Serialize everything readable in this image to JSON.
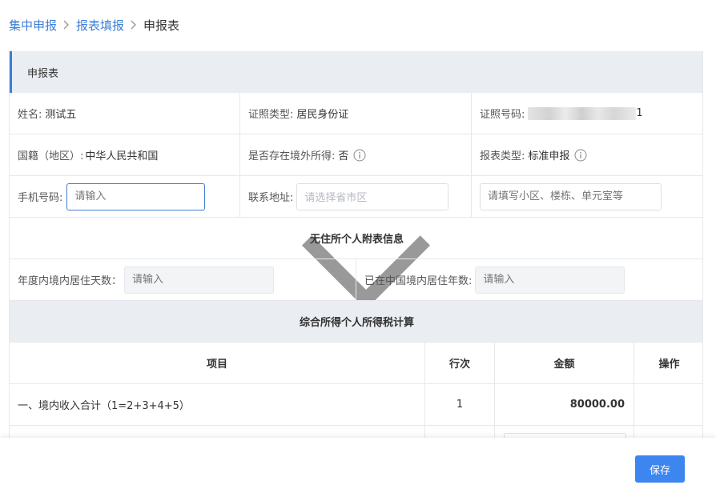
{
  "breadcrumb": {
    "items": [
      "集中申报",
      "报表填报",
      "申报表"
    ]
  },
  "section": {
    "title": "申报表"
  },
  "basic_info": {
    "name_label": "姓名:",
    "name_value": "测试五",
    "id_type_label": "证照类型:",
    "id_type_value": "居民身份证",
    "id_number_label": "证照号码:",
    "id_number_suffix": "1",
    "nationality_label": "国籍（地区）:",
    "nationality_value": "中华人民共和国",
    "overseas_income_label": "是否存在境外所得:",
    "overseas_income_value": "否",
    "report_type_label": "报表类型:",
    "report_type_value": "标准申报",
    "phone_label": "手机号码:",
    "phone_placeholder": "请输入",
    "address_label": "联系地址:",
    "address_placeholder": "请选择省市区",
    "detail_address_placeholder": "请填写小区、楼栋、单元室等"
  },
  "non_resident": {
    "title": "无住所个人附表信息",
    "days_label": "年度内境内居住天数：",
    "days_placeholder": "请输入",
    "years_label": "已在中国境内居住年数:",
    "years_placeholder": "请输入"
  },
  "tax_calc": {
    "title": "综合所得个人所得税计算",
    "columns": [
      "项目",
      "行次",
      "金额",
      "操作"
    ],
    "rows": [
      {
        "item": "一、境内收入合计（1=2+3+4+5）",
        "line": "1",
        "amount": "80000.00"
      }
    ]
  },
  "footer": {
    "save_label": "保存"
  },
  "colors": {
    "accent": "#3d7fd6",
    "button": "#3d86f0",
    "header_band": "#eaedf2"
  }
}
